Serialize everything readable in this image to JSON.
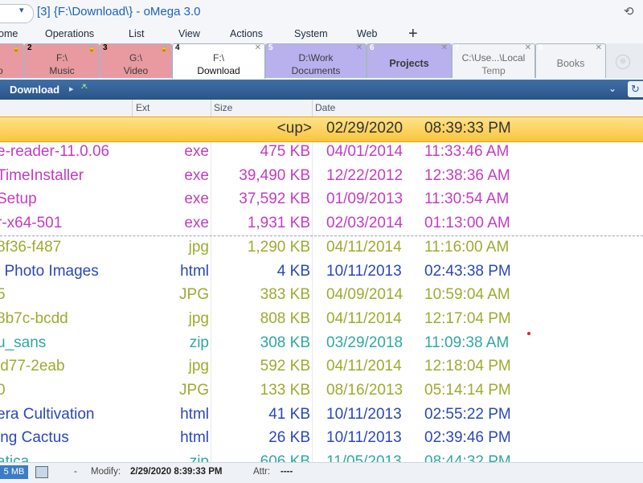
{
  "app": {
    "title": "[3] {F:\\Download\\} - oMega 3.0",
    "title_pill_chevron": "▾"
  },
  "menu": [
    "ome",
    "Operations",
    "List",
    "View",
    "Actions",
    "System",
    "Web"
  ],
  "menu_add": "+",
  "tabs": [
    {
      "num": "",
      "l1": "",
      "l2": "o",
      "color": "#e89aa0",
      "lock": true
    },
    {
      "num": "2",
      "l1": "F:\\",
      "l2": "Music",
      "color": "#e89aa0",
      "lock": true
    },
    {
      "num": "3",
      "l1": "G:\\",
      "l2": "Video",
      "color": "#e89aa0",
      "lock": true
    },
    {
      "num": "4",
      "l1": "F:\\",
      "l2": "Download",
      "color": "#ffffff",
      "close": true
    },
    {
      "num": "5",
      "l1": "D:\\Work",
      "l2": "Documents",
      "color": "#b9b1ee",
      "close": true
    },
    {
      "num": "6",
      "one": "Projects",
      "color": "#b9b1ee",
      "close": true
    },
    {
      "num": "7",
      "l1": "C:\\Use...\\Local",
      "l2": "Temp",
      "color": "#f2f4f7",
      "close": true
    },
    {
      "num": "8",
      "one": "Books",
      "color": "#f2f4f7",
      "close": true
    }
  ],
  "path": {
    "label": "Download",
    "arrow": "▸",
    "dots": "·*·"
  },
  "columns": {
    "ext": "Ext",
    "size": "Size",
    "date": "Date"
  },
  "up_row": {
    "size": "<up>",
    "date": "02/29/2020",
    "time": "08:39:33 PM"
  },
  "rows": [
    {
      "name": "e-reader-11.0.06",
      "ext": "exe",
      "size": "475 KB",
      "date": "04/01/2014",
      "time": "11:33:46 AM",
      "color": "#c43cc4"
    },
    {
      "name": "TimeInstaller",
      "ext": "exe",
      "size": "39,490 KB",
      "date": "12/22/2012",
      "time": "12:38:36 AM",
      "color": "#c43cc4"
    },
    {
      "name": "Setup",
      "ext": "exe",
      "size": "37,592 KB",
      "date": "01/09/2013",
      "time": "11:30:54 AM",
      "color": "#c43cc4"
    },
    {
      "name": "r-x64-501",
      "ext": "exe",
      "size": "1,931 KB",
      "date": "02/03/2014",
      "time": "01:13:00 AM",
      "color": "#c43cc4"
    },
    {
      "name": "8f36-f487",
      "ext": "jpg",
      "size": "1,290 KB",
      "date": "04/11/2014",
      "time": "11:16:00 AM",
      "color": "#9eab2e"
    },
    {
      "name": "i Photo Images",
      "ext": "html",
      "size": "4 KB",
      "date": "10/11/2013",
      "time": "02:43:38 PM",
      "color": "#2a48b8"
    },
    {
      "name": "5",
      "ext": "JPG",
      "size": "383 KB",
      "date": "04/09/2014",
      "time": "10:59:04 AM",
      "color": "#9eab2e"
    },
    {
      "name": "8b7c-bcdd",
      "ext": "jpg",
      "size": "808 KB",
      "date": "04/11/2014",
      "time": "12:17:04 PM",
      "color": "#9eab2e"
    },
    {
      "name": "u_sans",
      "ext": "zip",
      "size": "308 KB",
      "date": "03/29/2018",
      "time": "11:09:38 AM",
      "color": "#2fa8a0"
    },
    {
      "name": "ld77-2eab",
      "ext": "jpg",
      "size": "592 KB",
      "date": "04/11/2014",
      "time": "12:18:04 PM",
      "color": "#9eab2e"
    },
    {
      "name": "0",
      "ext": "JPG",
      "size": "133 KB",
      "date": "08/16/2013",
      "time": "05:14:14 PM",
      "color": "#9eab2e"
    },
    {
      "name": "era Cultivation",
      "ext": "html",
      "size": "41 KB",
      "date": "10/11/2013",
      "time": "02:55:22 PM",
      "color": "#2a48b8"
    },
    {
      "name": "ing Cactus",
      "ext": "html",
      "size": "26 KB",
      "date": "10/11/2013",
      "time": "02:39:46 PM",
      "color": "#2a48b8"
    },
    {
      "name": "atica",
      "ext": "zip",
      "size": "606 KB",
      "date": "11/05/2013",
      "time": "08:44:32 PM",
      "color": "#2fa8a0"
    }
  ],
  "status": {
    "size": "5 MB",
    "dash": "-",
    "modify_label": "Modify:",
    "modify_value": "2/29/2020 8:39:33 PM",
    "attr_label": "Attr:",
    "attr_value": "----"
  }
}
